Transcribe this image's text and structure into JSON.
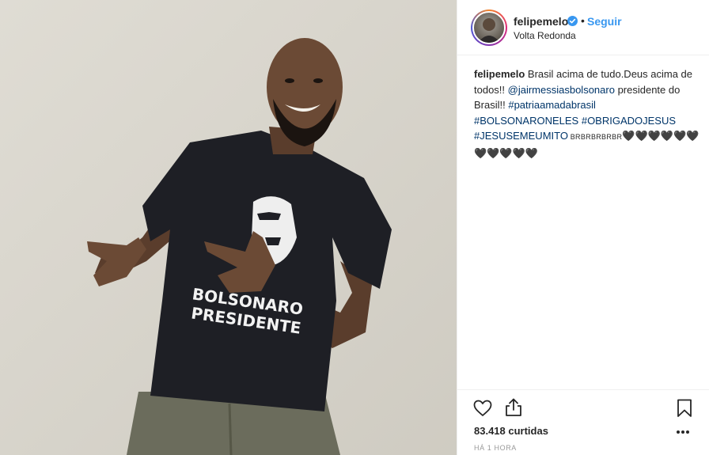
{
  "post": {
    "username": "felipemelo",
    "separator": "•",
    "follow_label": "Seguir",
    "location": "Volta Redonda",
    "verified_icon": "verified-badge-icon"
  },
  "caption": {
    "username": "felipemelo",
    "text1": " Brasil acima de tudo.Deus acima de todos!! ",
    "mention": "@jairmessiasbolsonaro",
    "text2": " presidente do Brasil!! ",
    "hashtag1": "#patriaamadabrasil",
    "hashtag2": "#BOLSONARONELES",
    "hashtag3": "#OBRIGADOJESUS",
    "hashtag4": "#JESUSEMEUMITO",
    "brbr": " BRBRBRBRBR",
    "hearts": "🖤🖤🖤🖤🖤🖤🖤🖤🖤🖤🖤"
  },
  "photo": {
    "shirt_line1": "BOLSONARO",
    "shirt_line2": "PRESIDENTE"
  },
  "stats": {
    "likes": "83.418 curtidas",
    "time": "HÁ 1 HORA"
  },
  "colors": {
    "link": "#003569",
    "follow": "#3897f0",
    "wall": "#d9d6cd",
    "shirt": "#1c1d22"
  }
}
